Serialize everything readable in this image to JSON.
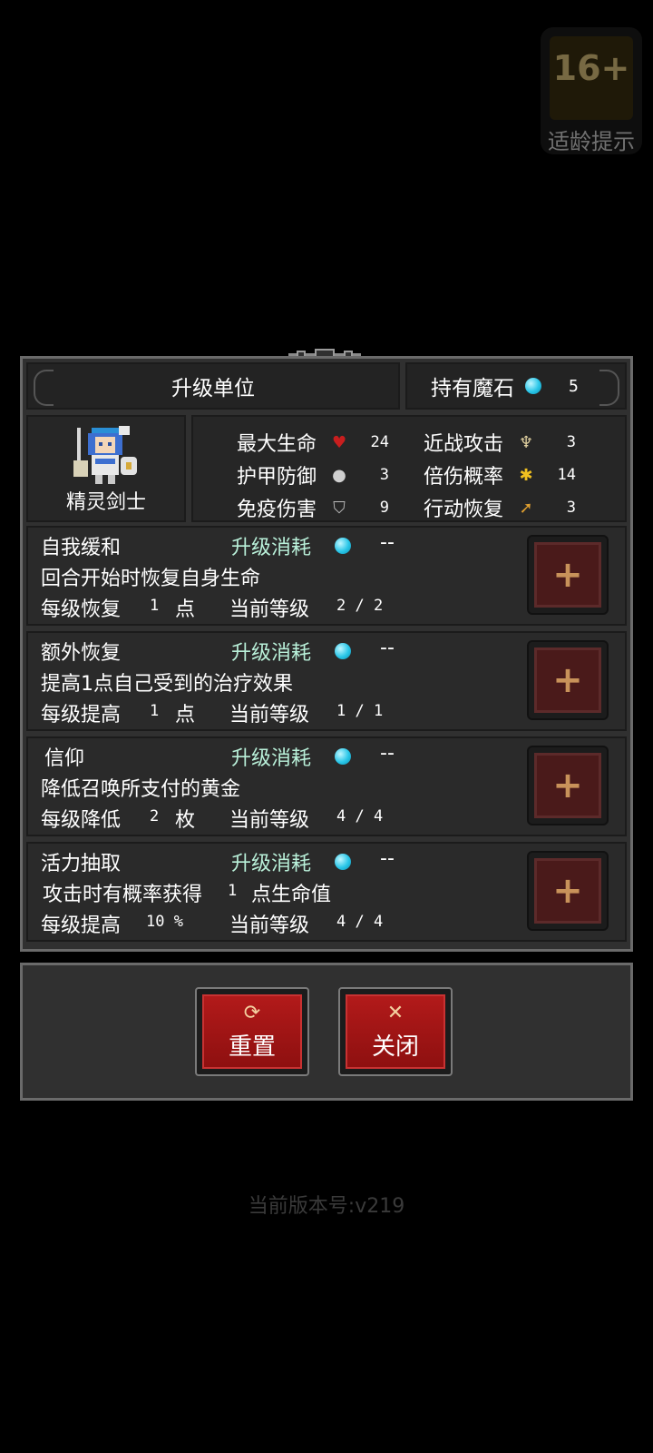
{
  "age_badge": {
    "rating": "16+",
    "label": "适龄提示"
  },
  "header": {
    "title": "升级单位",
    "stones_label": "持有魔石",
    "stones_value": "5"
  },
  "unit": {
    "name": "精灵剑士",
    "stats": [
      {
        "label": "最大生命",
        "icon": "heart-icon",
        "value": "24"
      },
      {
        "label": "近战攻击",
        "icon": "sword-icon",
        "value": "3"
      },
      {
        "label": "护甲防御",
        "icon": "armor-icon",
        "value": "3"
      },
      {
        "label": "倍伤概率",
        "icon": "crit-icon",
        "value": "14"
      },
      {
        "label": "免疫伤害",
        "icon": "shield-icon",
        "value": "9"
      },
      {
        "label": "行动恢复",
        "icon": "boot-icon",
        "value": "3"
      }
    ]
  },
  "skills": [
    {
      "name": "自我缓和",
      "cost_label": "升级消耗",
      "cost_value": "--",
      "desc": "回合开始时恢复自身生命",
      "per_level_label": "每级恢复",
      "per_level_value": "1",
      "per_level_unit": "点",
      "level_label": "当前等级",
      "level": "2 / 2"
    },
    {
      "name": "额外恢复",
      "cost_label": "升级消耗",
      "cost_value": "--",
      "desc": "提高1点自己受到的治疗效果",
      "per_level_label": "每级提高",
      "per_level_value": "1",
      "per_level_unit": "点",
      "level_label": "当前等级",
      "level": "1 / 1"
    },
    {
      "name": "信仰",
      "cost_label": "升级消耗",
      "cost_value": "--",
      "desc": "降低召唤所支付的黄金",
      "per_level_label": "每级降低",
      "per_level_value": "2",
      "per_level_unit": "枚",
      "level_label": "当前等级",
      "level": "4 / 4"
    },
    {
      "name": "活力抽取",
      "cost_label": "升级消耗",
      "cost_value": "--",
      "desc_prefix": "攻击时有概率获得",
      "desc_num": "1",
      "desc_suffix": "点生命值",
      "per_level_label": "每级提高",
      "per_level_value": "10 %",
      "per_level_unit": "",
      "level_label": "当前等级",
      "level": "4 / 4"
    }
  ],
  "buttons": {
    "reset": "重置",
    "close": "关闭"
  },
  "version": "当前版本号:v219",
  "colors": {
    "panel": "#303030",
    "accent_red": "#b21a1a",
    "gem": "#29c6e8",
    "cost_text": "#b9f0d9"
  }
}
